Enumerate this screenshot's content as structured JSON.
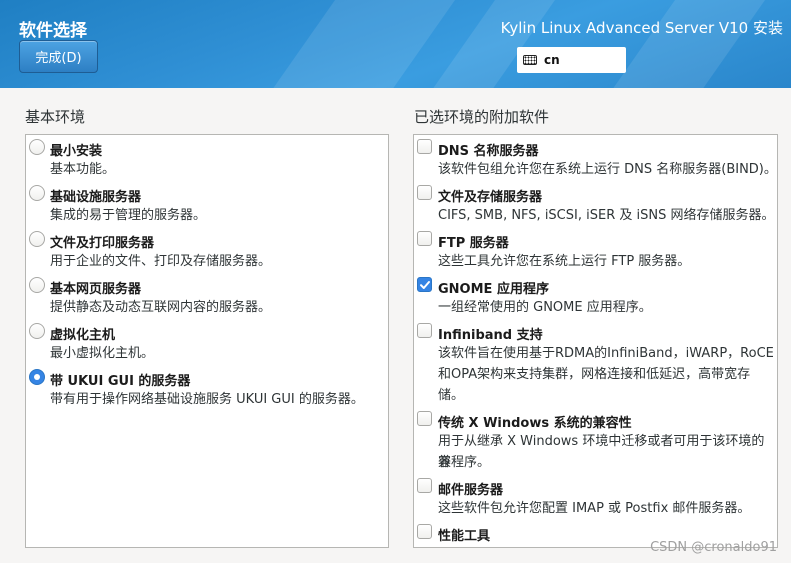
{
  "header": {
    "title": "软件选择",
    "done_label": "完成(D)",
    "product_title": "Kylin Linux Advanced Server V10 安装",
    "keyboard_layout": "cn",
    "accent_color": "#2f8fd4"
  },
  "base_environment": {
    "heading": "基本环境",
    "selected": "带 UKUI GUI 的服务器",
    "items": [
      {
        "title": "最小安装",
        "desc": "基本功能。",
        "selected": false
      },
      {
        "title": "基础设施服务器",
        "desc": "集成的易于管理的服务器。",
        "selected": false
      },
      {
        "title": "文件及打印服务器",
        "desc": "用于企业的文件、打印及存储服务器。",
        "selected": false
      },
      {
        "title": "基本网页服务器",
        "desc": "提供静态及动态互联网内容的服务器。",
        "selected": false
      },
      {
        "title": "虚拟化主机",
        "desc": "最小虚拟化主机。",
        "selected": false
      },
      {
        "title": "带 UKUI GUI 的服务器",
        "desc": "带有用于操作网络基础设施服务 UKUI GUI 的服务器。",
        "selected": true
      }
    ]
  },
  "addons": {
    "heading": "已选环境的附加软件",
    "items": [
      {
        "title": "DNS 名称服务器",
        "desc": [
          "该软件包组允许您在系统上运行 DNS 名称服务器(BIND)。"
        ],
        "checked": false
      },
      {
        "title": "文件及存储服务器",
        "desc": [
          "CIFS, SMB, NFS, iSCSI, iSER 及 iSNS 网络存储服务器。"
        ],
        "checked": false
      },
      {
        "title": "FTP 服务器",
        "desc": [
          "这些工具允许您在系统上运行 FTP 服务器。"
        ],
        "checked": false
      },
      {
        "title": "GNOME 应用程序",
        "desc": [
          "一组经常使用的 GNOME 应用程序。"
        ],
        "checked": true
      },
      {
        "title": "Infiniband 支持",
        "desc": [
          "该软件旨在使用基于RDMA的InfiniBand，iWARP，RoCE",
          "和OPA架构来支持集群，网格连接和低延迟，高带宽存",
          "储。"
        ],
        "checked": false
      },
      {
        "title": "传统 X Windows 系统的兼容性",
        "desc": [
          "用于从继承 X Windows 环境中迁移或者可用于该环境的兼",
          "容程序。"
        ],
        "checked": false
      },
      {
        "title": "邮件服务器",
        "desc": [
          "这些软件包允许您配置 IMAP 或 Postfix 邮件服务器。"
        ],
        "checked": false
      },
      {
        "title": "性能工具",
        "desc": [],
        "checked": false
      }
    ]
  },
  "watermark": "CSDN @cronaldo91"
}
